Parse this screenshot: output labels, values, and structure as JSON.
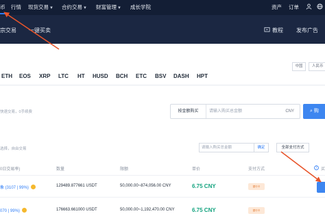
{
  "top_nav": {
    "items": [
      {
        "label": "币"
      },
      {
        "label": "行情"
      },
      {
        "label": "现货交易",
        "has_dropdown": true
      },
      {
        "label": "合约交易",
        "has_dropdown": true
      },
      {
        "label": "财富管理",
        "has_dropdown": true
      },
      {
        "label": "成长学院"
      }
    ],
    "right_items": [
      {
        "label": "资产"
      },
      {
        "label": "订单"
      }
    ],
    "right_icons": [
      "user-icon",
      "globe-icon"
    ]
  },
  "sub_nav": {
    "tabs": [
      {
        "label": "宗交易"
      },
      {
        "label": "一键买卖"
      }
    ],
    "right_links": [
      {
        "label": "教程",
        "icon": "tutorial-icon"
      },
      {
        "label": "发布广告"
      }
    ]
  },
  "currencies": [
    "ETH",
    "EOS",
    "XRP",
    "LTC",
    "HT",
    "HUSD",
    "BCH",
    "ETC",
    "BSV",
    "DASH",
    "HPT"
  ],
  "region": {
    "left": "中国",
    "right": "人民币"
  },
  "quick_trade": {
    "hint": "快速交易，0手续费",
    "mode": "按金额购买",
    "placeholder": "请输入购买总金额",
    "unit": "CNY",
    "buy_label": "购"
  },
  "filter": {
    "hint": "选择，自由交易",
    "placeholder": "请输入购买总金额",
    "confirm": "确定",
    "payment_select": "全部支付方式"
  },
  "table": {
    "headers": {
      "merchant": "0日交易率)",
      "quantity": "数量",
      "limit": "限额",
      "price": "单价",
      "payment": "支付方式",
      "action": "买"
    },
    "rows": [
      {
        "merchant": "象 (3107 | 99%)",
        "quantity": "129489.877661 USDT",
        "limit": "50,000.00~874,056.00 CNY",
        "price": "6.75 CNY",
        "payment": "银行卡"
      },
      {
        "merchant": "070 | 99%)",
        "quantity": "176663.661000 USDT",
        "limit": "50,000.00~1,192,470.00 CNY",
        "price": "6.75 CNY",
        "payment": "银行卡"
      }
    ]
  },
  "colors": {
    "nav_bg": "#131e35",
    "subnav_bg": "#1b2742",
    "accent": "#2e7cf6",
    "price_green": "#14a37f",
    "annotation_arrow": "#e8542a"
  }
}
